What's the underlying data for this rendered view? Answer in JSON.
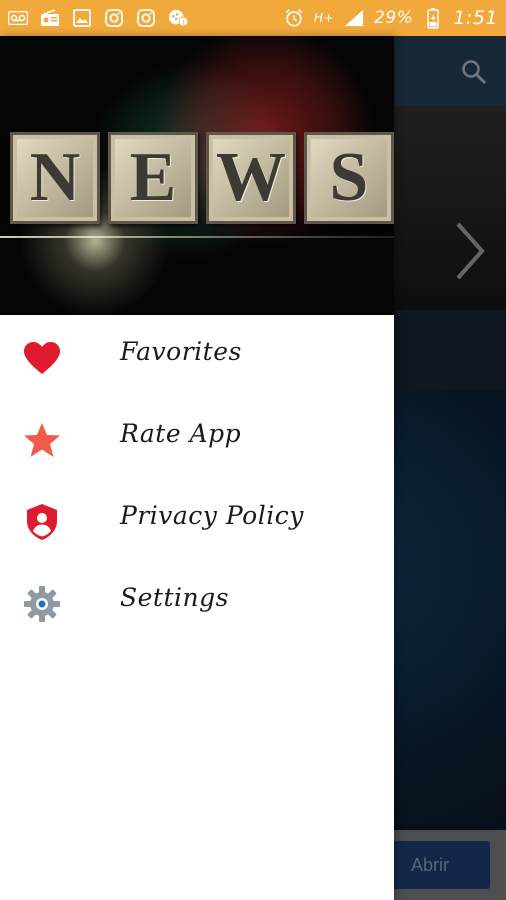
{
  "status_bar": {
    "battery_percent": "29%",
    "time": "1:51",
    "network": "H+",
    "left_icons": [
      "voicemail-icon",
      "radio-icon",
      "image-icon",
      "instagram-icon",
      "instagram-icon",
      "notification-badge-icon"
    ],
    "right_icons": [
      "alarm-icon",
      "signal-icon",
      "battery-charging-icon"
    ],
    "color": "#f2a93b"
  },
  "drawer": {
    "header": {
      "letters": [
        "N",
        "E",
        "W",
        "S"
      ]
    },
    "items": [
      {
        "label": "Favorites",
        "icon": "heart-icon",
        "icon_color": "#e01b2f"
      },
      {
        "label": "Rate App",
        "icon": "star-icon",
        "icon_color": "#f25a4a"
      },
      {
        "label": "Privacy Policy",
        "icon": "shield-user-icon",
        "icon_color": "#e01b2f"
      },
      {
        "label": "Settings",
        "icon": "gear-icon",
        "icon_color": "#6b7785"
      }
    ]
  },
  "background_app": {
    "open_button_label": "Abrir"
  }
}
